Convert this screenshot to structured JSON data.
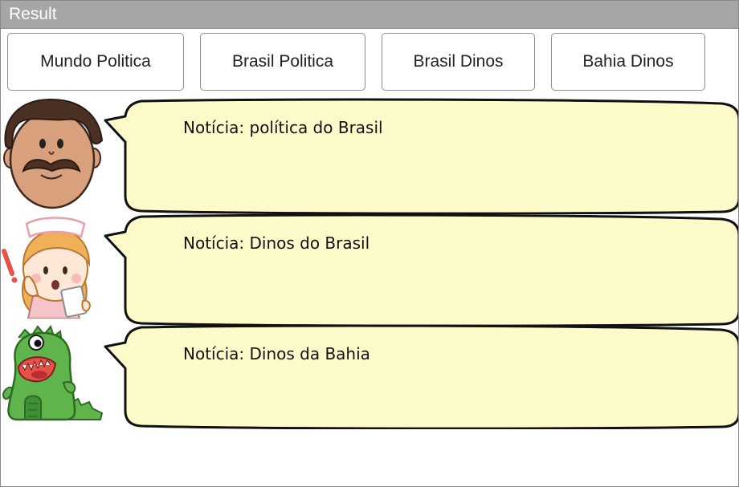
{
  "window": {
    "title": "Result"
  },
  "buttons": [
    {
      "label": "Mundo Politica"
    },
    {
      "label": "Brasil Politica"
    },
    {
      "label": "Brasil Dinos"
    },
    {
      "label": "Bahia Dinos"
    }
  ],
  "messages": [
    {
      "text": "Notícia: política do Brasil",
      "avatar": "mustache-man-icon"
    },
    {
      "text": "Notícia: Dinos do Brasil",
      "avatar": "nurse-girl-icon"
    },
    {
      "text": "Notícia: Dinos da Bahia",
      "avatar": "green-dino-icon"
    }
  ],
  "colors": {
    "titlebar": "#a6a6a6",
    "bubble_fill": "#fefbcb",
    "bubble_stroke": "#111111",
    "dino_green": "#5fb54c"
  }
}
